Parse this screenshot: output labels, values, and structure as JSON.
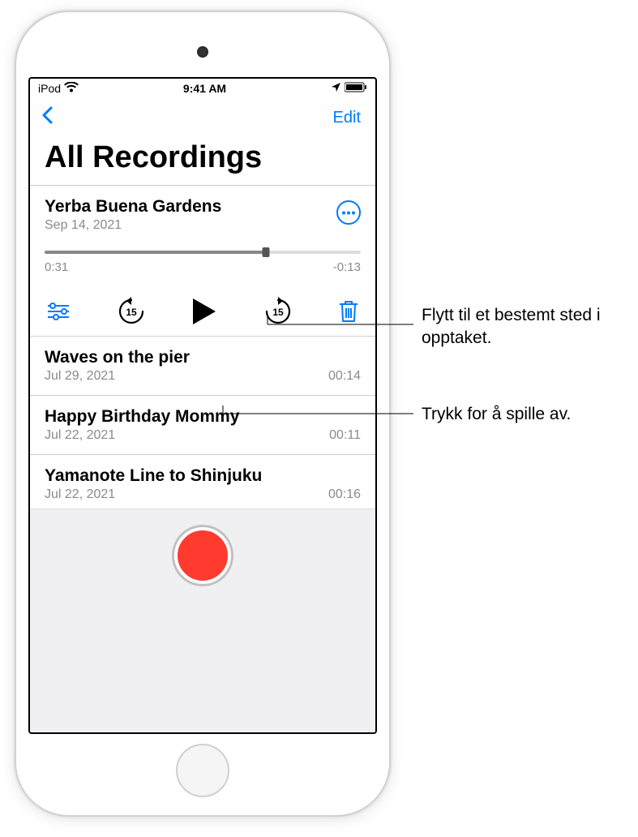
{
  "status_bar": {
    "carrier": "iPod",
    "time": "9:41 AM"
  },
  "nav": {
    "edit_label": "Edit"
  },
  "page_title": "All Recordings",
  "expanded": {
    "title": "Yerba Buena Gardens",
    "date": "Sep 14, 2021",
    "elapsed": "0:31",
    "remaining": "-0:13",
    "skip_amount": "15"
  },
  "recordings": [
    {
      "title": "Waves on the pier",
      "date": "Jul 29, 2021",
      "duration": "00:14"
    },
    {
      "title": "Happy Birthday Mommy",
      "date": "Jul 22, 2021",
      "duration": "00:11"
    },
    {
      "title": "Yamanote Line to Shinjuku",
      "date": "Jul 22, 2021",
      "duration": "00:16"
    }
  ],
  "callouts": {
    "scrubber": "Flytt til et bestemt sted i opptaket.",
    "play": "Trykk for å spille av."
  }
}
